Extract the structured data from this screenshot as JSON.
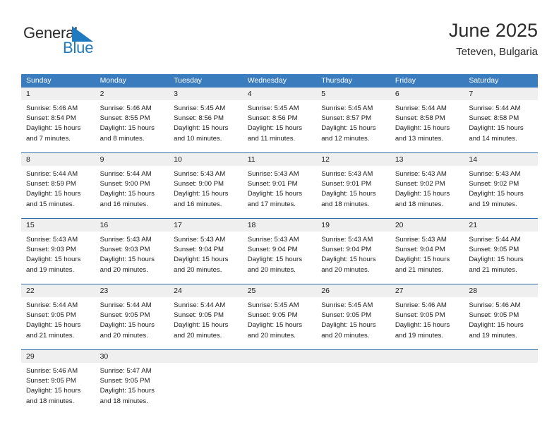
{
  "brand": {
    "name_top": "General",
    "name_bottom": "Blue",
    "mark_icon": "blue-triangle-icon",
    "accent_color": "#1f7ac0"
  },
  "header": {
    "title": "June 2025",
    "subtitle": "Teteven, Bulgaria"
  },
  "theme": {
    "header_bg": "#3a7cbe",
    "row_divider": "#2f6ca8",
    "daynum_bg": "#efefef",
    "text": "#1c1c1c"
  },
  "calendar": {
    "weekday_headers": [
      "Sunday",
      "Monday",
      "Tuesday",
      "Wednesday",
      "Thursday",
      "Friday",
      "Saturday"
    ],
    "weeks": [
      [
        {
          "day": "1",
          "sunrise": "Sunrise: 5:46 AM",
          "sunset": "Sunset: 8:54 PM",
          "daylight_1": "Daylight: 15 hours",
          "daylight_2": "and 7 minutes."
        },
        {
          "day": "2",
          "sunrise": "Sunrise: 5:46 AM",
          "sunset": "Sunset: 8:55 PM",
          "daylight_1": "Daylight: 15 hours",
          "daylight_2": "and 8 minutes."
        },
        {
          "day": "3",
          "sunrise": "Sunrise: 5:45 AM",
          "sunset": "Sunset: 8:56 PM",
          "daylight_1": "Daylight: 15 hours",
          "daylight_2": "and 10 minutes."
        },
        {
          "day": "4",
          "sunrise": "Sunrise: 5:45 AM",
          "sunset": "Sunset: 8:56 PM",
          "daylight_1": "Daylight: 15 hours",
          "daylight_2": "and 11 minutes."
        },
        {
          "day": "5",
          "sunrise": "Sunrise: 5:45 AM",
          "sunset": "Sunset: 8:57 PM",
          "daylight_1": "Daylight: 15 hours",
          "daylight_2": "and 12 minutes."
        },
        {
          "day": "6",
          "sunrise": "Sunrise: 5:44 AM",
          "sunset": "Sunset: 8:58 PM",
          "daylight_1": "Daylight: 15 hours",
          "daylight_2": "and 13 minutes."
        },
        {
          "day": "7",
          "sunrise": "Sunrise: 5:44 AM",
          "sunset": "Sunset: 8:58 PM",
          "daylight_1": "Daylight: 15 hours",
          "daylight_2": "and 14 minutes."
        }
      ],
      [
        {
          "day": "8",
          "sunrise": "Sunrise: 5:44 AM",
          "sunset": "Sunset: 8:59 PM",
          "daylight_1": "Daylight: 15 hours",
          "daylight_2": "and 15 minutes."
        },
        {
          "day": "9",
          "sunrise": "Sunrise: 5:44 AM",
          "sunset": "Sunset: 9:00 PM",
          "daylight_1": "Daylight: 15 hours",
          "daylight_2": "and 16 minutes."
        },
        {
          "day": "10",
          "sunrise": "Sunrise: 5:43 AM",
          "sunset": "Sunset: 9:00 PM",
          "daylight_1": "Daylight: 15 hours",
          "daylight_2": "and 16 minutes."
        },
        {
          "day": "11",
          "sunrise": "Sunrise: 5:43 AM",
          "sunset": "Sunset: 9:01 PM",
          "daylight_1": "Daylight: 15 hours",
          "daylight_2": "and 17 minutes."
        },
        {
          "day": "12",
          "sunrise": "Sunrise: 5:43 AM",
          "sunset": "Sunset: 9:01 PM",
          "daylight_1": "Daylight: 15 hours",
          "daylight_2": "and 18 minutes."
        },
        {
          "day": "13",
          "sunrise": "Sunrise: 5:43 AM",
          "sunset": "Sunset: 9:02 PM",
          "daylight_1": "Daylight: 15 hours",
          "daylight_2": "and 18 minutes."
        },
        {
          "day": "14",
          "sunrise": "Sunrise: 5:43 AM",
          "sunset": "Sunset: 9:02 PM",
          "daylight_1": "Daylight: 15 hours",
          "daylight_2": "and 19 minutes."
        }
      ],
      [
        {
          "day": "15",
          "sunrise": "Sunrise: 5:43 AM",
          "sunset": "Sunset: 9:03 PM",
          "daylight_1": "Daylight: 15 hours",
          "daylight_2": "and 19 minutes."
        },
        {
          "day": "16",
          "sunrise": "Sunrise: 5:43 AM",
          "sunset": "Sunset: 9:03 PM",
          "daylight_1": "Daylight: 15 hours",
          "daylight_2": "and 20 minutes."
        },
        {
          "day": "17",
          "sunrise": "Sunrise: 5:43 AM",
          "sunset": "Sunset: 9:04 PM",
          "daylight_1": "Daylight: 15 hours",
          "daylight_2": "and 20 minutes."
        },
        {
          "day": "18",
          "sunrise": "Sunrise: 5:43 AM",
          "sunset": "Sunset: 9:04 PM",
          "daylight_1": "Daylight: 15 hours",
          "daylight_2": "and 20 minutes."
        },
        {
          "day": "19",
          "sunrise": "Sunrise: 5:43 AM",
          "sunset": "Sunset: 9:04 PM",
          "daylight_1": "Daylight: 15 hours",
          "daylight_2": "and 20 minutes."
        },
        {
          "day": "20",
          "sunrise": "Sunrise: 5:43 AM",
          "sunset": "Sunset: 9:04 PM",
          "daylight_1": "Daylight: 15 hours",
          "daylight_2": "and 21 minutes."
        },
        {
          "day": "21",
          "sunrise": "Sunrise: 5:44 AM",
          "sunset": "Sunset: 9:05 PM",
          "daylight_1": "Daylight: 15 hours",
          "daylight_2": "and 21 minutes."
        }
      ],
      [
        {
          "day": "22",
          "sunrise": "Sunrise: 5:44 AM",
          "sunset": "Sunset: 9:05 PM",
          "daylight_1": "Daylight: 15 hours",
          "daylight_2": "and 21 minutes."
        },
        {
          "day": "23",
          "sunrise": "Sunrise: 5:44 AM",
          "sunset": "Sunset: 9:05 PM",
          "daylight_1": "Daylight: 15 hours",
          "daylight_2": "and 20 minutes."
        },
        {
          "day": "24",
          "sunrise": "Sunrise: 5:44 AM",
          "sunset": "Sunset: 9:05 PM",
          "daylight_1": "Daylight: 15 hours",
          "daylight_2": "and 20 minutes."
        },
        {
          "day": "25",
          "sunrise": "Sunrise: 5:45 AM",
          "sunset": "Sunset: 9:05 PM",
          "daylight_1": "Daylight: 15 hours",
          "daylight_2": "and 20 minutes."
        },
        {
          "day": "26",
          "sunrise": "Sunrise: 5:45 AM",
          "sunset": "Sunset: 9:05 PM",
          "daylight_1": "Daylight: 15 hours",
          "daylight_2": "and 20 minutes."
        },
        {
          "day": "27",
          "sunrise": "Sunrise: 5:46 AM",
          "sunset": "Sunset: 9:05 PM",
          "daylight_1": "Daylight: 15 hours",
          "daylight_2": "and 19 minutes."
        },
        {
          "day": "28",
          "sunrise": "Sunrise: 5:46 AM",
          "sunset": "Sunset: 9:05 PM",
          "daylight_1": "Daylight: 15 hours",
          "daylight_2": "and 19 minutes."
        }
      ],
      [
        {
          "day": "29",
          "sunrise": "Sunrise: 5:46 AM",
          "sunset": "Sunset: 9:05 PM",
          "daylight_1": "Daylight: 15 hours",
          "daylight_2": "and 18 minutes."
        },
        {
          "day": "30",
          "sunrise": "Sunrise: 5:47 AM",
          "sunset": "Sunset: 9:05 PM",
          "daylight_1": "Daylight: 15 hours",
          "daylight_2": "and 18 minutes."
        },
        {
          "day": "",
          "sunrise": "",
          "sunset": "",
          "daylight_1": "",
          "daylight_2": ""
        },
        {
          "day": "",
          "sunrise": "",
          "sunset": "",
          "daylight_1": "",
          "daylight_2": ""
        },
        {
          "day": "",
          "sunrise": "",
          "sunset": "",
          "daylight_1": "",
          "daylight_2": ""
        },
        {
          "day": "",
          "sunrise": "",
          "sunset": "",
          "daylight_1": "",
          "daylight_2": ""
        },
        {
          "day": "",
          "sunrise": "",
          "sunset": "",
          "daylight_1": "",
          "daylight_2": ""
        }
      ]
    ]
  }
}
